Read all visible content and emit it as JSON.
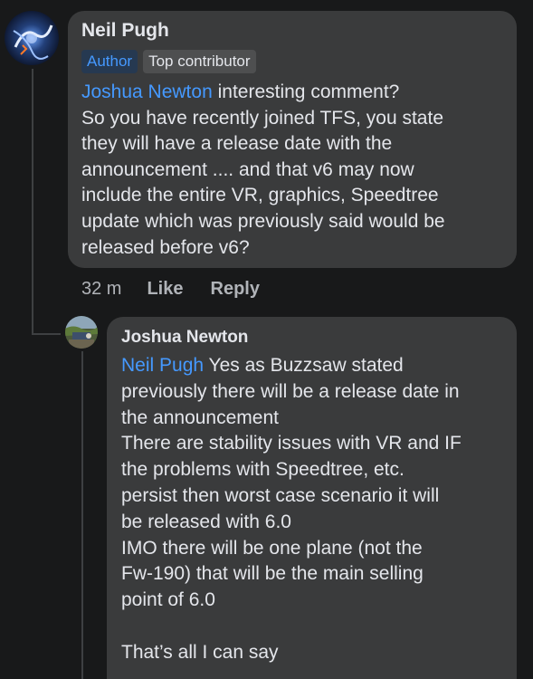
{
  "comment": {
    "author": "Neil Pugh",
    "badges": [
      "Author",
      "Top contributor"
    ],
    "mention": "Joshua Newton",
    "text": " interesting comment?\nSo you have recently joined TFS, you state\nthey will have a release date with the\nannouncement .... and that v6 may now\ninclude the entire VR, graphics, Speedtree\nupdate which was previously said would be\nreleased before v6?",
    "time": "32 m",
    "like_label": "Like",
    "reply_label": "Reply"
  },
  "reply": {
    "author": "Joshua Newton",
    "mention": "Neil Pugh",
    "text": " Yes as Buzzsaw stated\npreviously there will be a release date in\nthe announcement\nThere are stability issues with VR and IF\nthe problems with Speedtree, etc.\npersist then worst case scenario it will\nbe released with 6.0\nIMO there will be one plane (not the\nFw-190) that will be the main selling\npoint of 6.0\n\nThat’s all I can say"
  },
  "colors": {
    "background": "#18191a",
    "bubble": "#3a3b3c",
    "mention": "#4599ff",
    "text": "#e4e6eb",
    "meta": "#b0b3b8"
  }
}
